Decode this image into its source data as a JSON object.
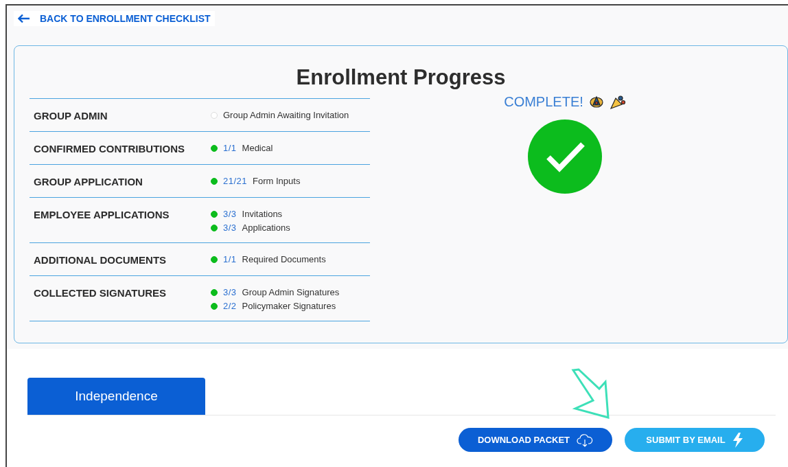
{
  "back_link": "BACK TO ENROLLMENT CHECKLIST",
  "title": "Enrollment Progress",
  "sections": [
    {
      "name": "GROUP ADMIN",
      "items": [
        {
          "complete": false,
          "text": "Group Admin Awaiting Invitation"
        }
      ]
    },
    {
      "name": "CONFIRMED CONTRIBUTIONS",
      "items": [
        {
          "complete": true,
          "count": "1/1",
          "text": "Medical"
        }
      ]
    },
    {
      "name": "GROUP APPLICATION",
      "items": [
        {
          "complete": true,
          "count": "21/21",
          "text": "Form Inputs"
        }
      ]
    },
    {
      "name": "EMPLOYEE APPLICATIONS",
      "items": [
        {
          "complete": true,
          "count": "3/3",
          "text": "Invitations"
        },
        {
          "complete": true,
          "count": "3/3",
          "text": "Applications"
        }
      ]
    },
    {
      "name": "ADDITIONAL DOCUMENTS",
      "items": [
        {
          "complete": true,
          "count": "1/1",
          "text": "Required Documents"
        }
      ]
    },
    {
      "name": "COLLECTED SIGNATURES",
      "items": [
        {
          "complete": true,
          "count": "3/3",
          "text": "Group Admin Signatures"
        },
        {
          "complete": true,
          "count": "2/2",
          "text": "Policymaker Signatures"
        }
      ]
    }
  ],
  "status": {
    "text": "COMPLETE!",
    "complete": true
  },
  "tabs": [
    {
      "label": "Independence",
      "selected": true
    }
  ],
  "buttons": [
    {
      "label": "DOWNLOAD PACKET",
      "kind": "download"
    },
    {
      "label": "SUBMIT BY EMAIL",
      "kind": "email"
    }
  ]
}
